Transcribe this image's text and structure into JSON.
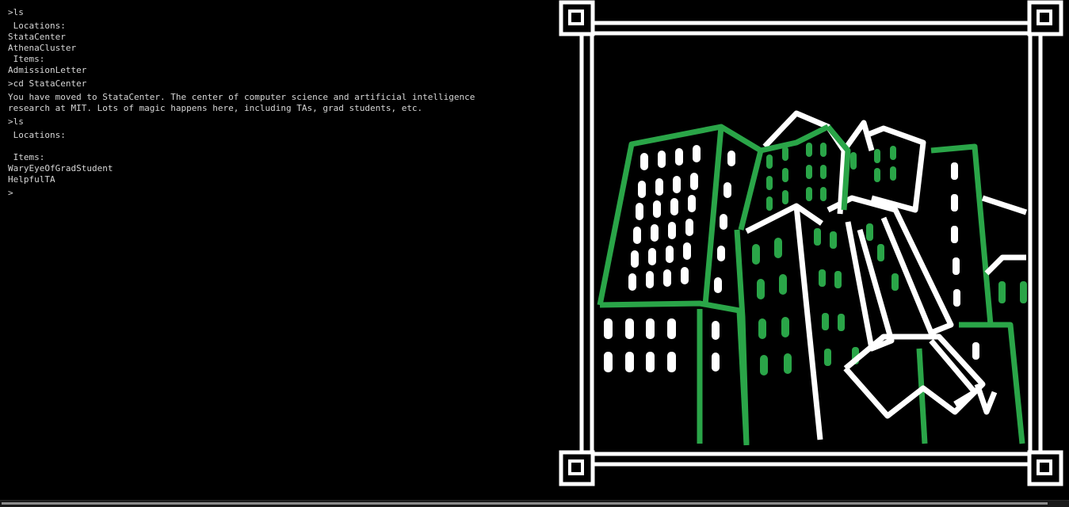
{
  "terminal": {
    "lines": [
      ">ls",
      " Locations:",
      "StataCenter",
      "AthenaCluster",
      " Items:",
      "AdmissionLetter",
      ">cd StataCenter",
      "You have moved to StataCenter. The center of computer science and artificial intelligence",
      "research at MIT. Lots of magic happens here, including TAs, grad students, etc.",
      ">ls",
      " Locations:",
      " Items:",
      "WaryEyeOfGradStudent",
      "HelpfulTA",
      ">"
    ]
  },
  "colors": {
    "background": "#000000",
    "terminal_text": "#d6d6d6",
    "art_green": "#2aa548",
    "art_white": "#ffffff"
  },
  "icons": {
    "art": "stata-center-building-illustration"
  }
}
